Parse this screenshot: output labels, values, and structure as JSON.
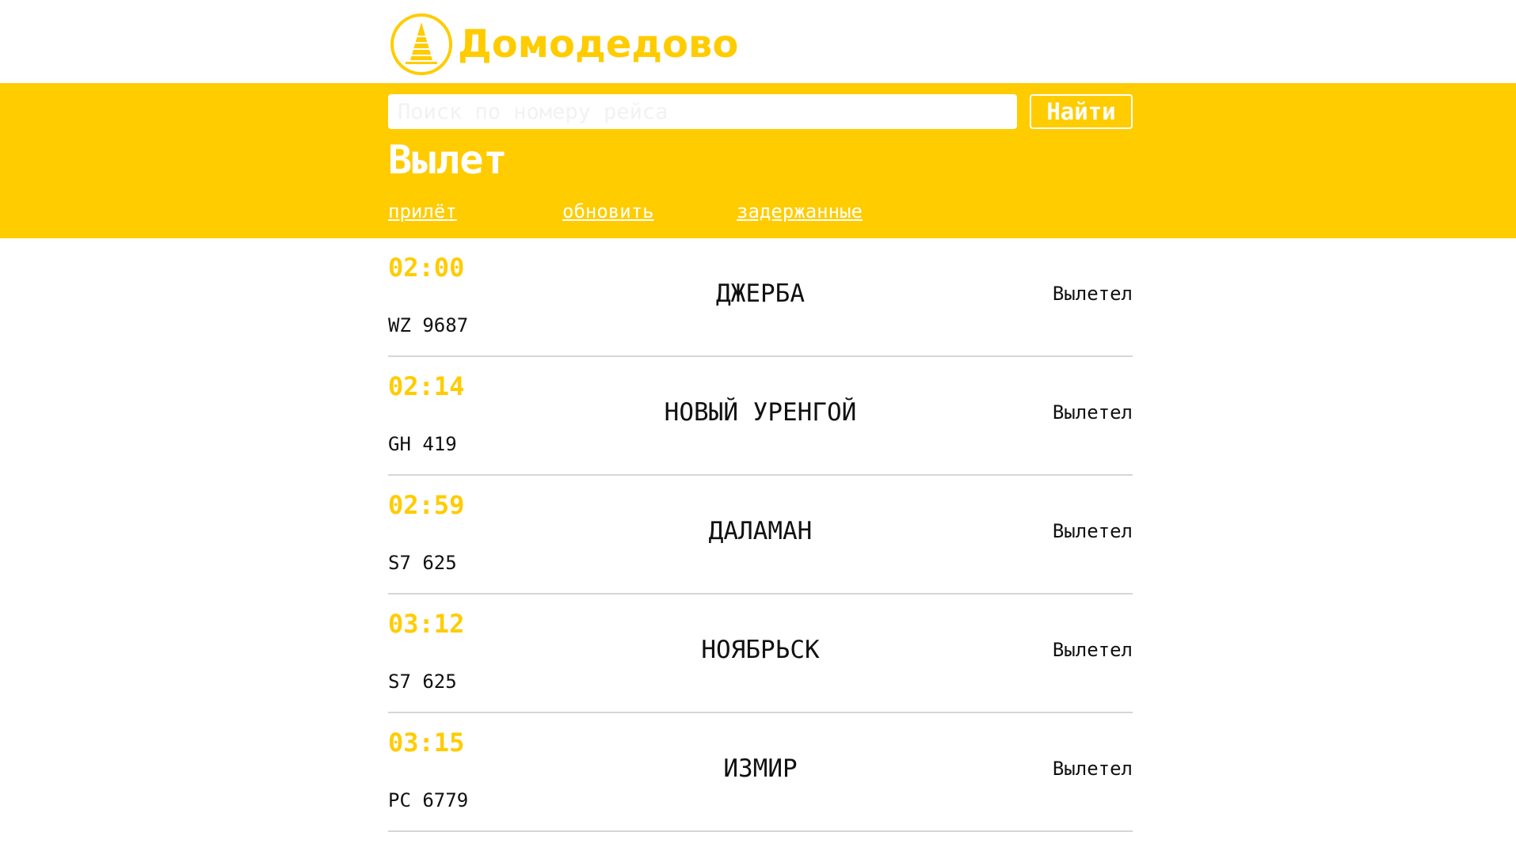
{
  "header": {
    "logo_text": "Домодедово",
    "logo_icon": "domodedovo-tower-icon",
    "brand_color": "#ffcc00"
  },
  "toolbar": {
    "search_placeholder": "Поиск по номеру рейса",
    "search_value": "",
    "search_button_label": "Найти",
    "page_title": "Вылет",
    "nav_links": [
      "прилёт",
      "обновить",
      "задержанные"
    ]
  },
  "flights": [
    {
      "time": "02:00",
      "flight": "WZ 9687",
      "city": "ДЖЕРБА",
      "status": "Вылетел"
    },
    {
      "time": "02:14",
      "flight": "GH 419",
      "city": "НОВЫЙ УРЕНГОЙ",
      "status": "Вылетел"
    },
    {
      "time": "02:59",
      "flight": "S7 625",
      "city": "ДАЛАМАН",
      "status": "Вылетел"
    },
    {
      "time": "03:12",
      "flight": "S7 625",
      "city": "НОЯБРЬСК",
      "status": "Вылетел"
    },
    {
      "time": "03:15",
      "flight": "PC 6779",
      "city": "ИЗМИР",
      "status": "Вылетел"
    }
  ]
}
